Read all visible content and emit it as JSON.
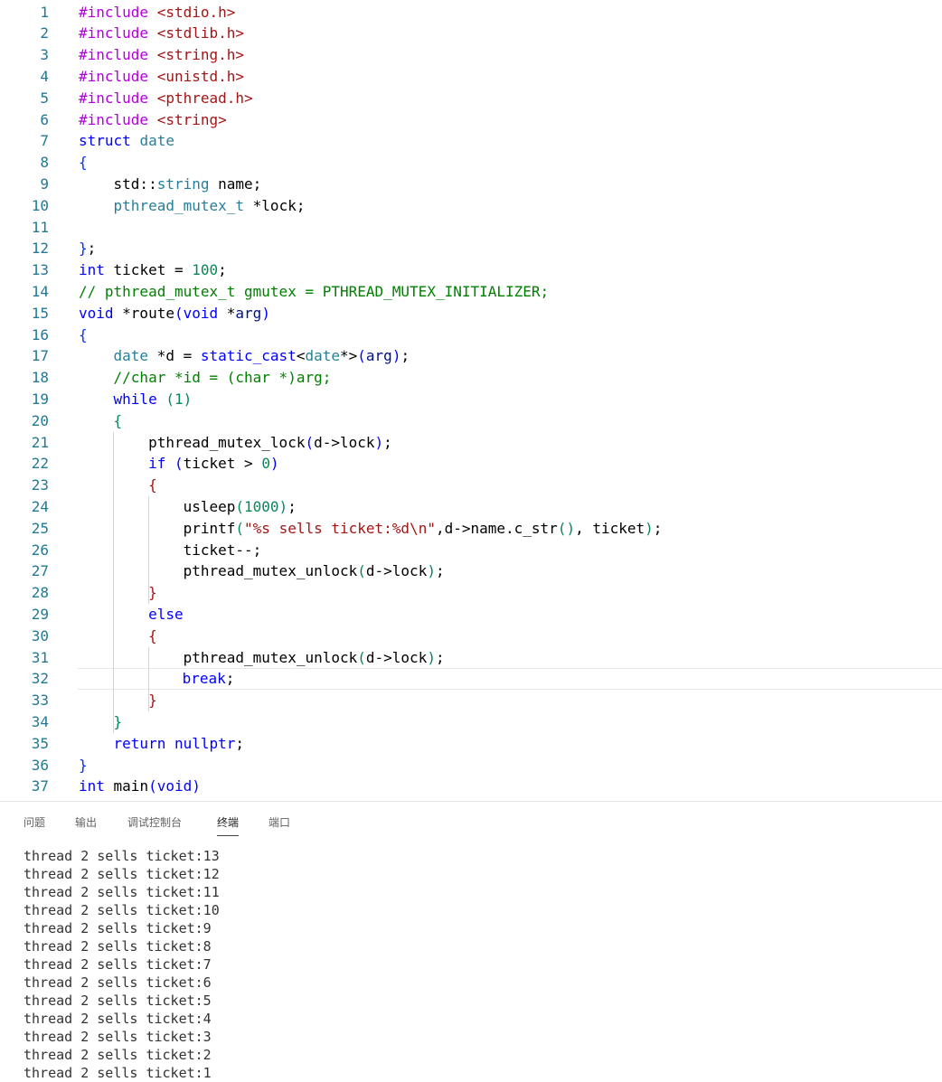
{
  "editor": {
    "lines": [
      {
        "n": "1",
        "segs": [
          [
            "pp",
            "#include "
          ],
          [
            "s",
            "<stdio.h>"
          ]
        ]
      },
      {
        "n": "2",
        "segs": [
          [
            "pp",
            "#include "
          ],
          [
            "s",
            "<stdlib.h>"
          ]
        ]
      },
      {
        "n": "3",
        "segs": [
          [
            "pp",
            "#include "
          ],
          [
            "s",
            "<string.h>"
          ]
        ]
      },
      {
        "n": "4",
        "segs": [
          [
            "pp",
            "#include "
          ],
          [
            "s",
            "<unistd.h>"
          ]
        ]
      },
      {
        "n": "5",
        "segs": [
          [
            "pp",
            "#include "
          ],
          [
            "s",
            "<pthread.h>"
          ]
        ]
      },
      {
        "n": "6",
        "segs": [
          [
            "pp",
            "#include "
          ],
          [
            "s",
            "<string>"
          ]
        ]
      },
      {
        "n": "7",
        "segs": [
          [
            "k",
            "struct "
          ],
          [
            "t",
            "date"
          ]
        ]
      },
      {
        "n": "8",
        "segs": [
          [
            "b",
            "{"
          ]
        ]
      },
      {
        "n": "9",
        "segs": [
          [
            "p",
            "    std::"
          ],
          [
            "t",
            "string"
          ],
          [
            "p",
            " name;"
          ]
        ]
      },
      {
        "n": "10",
        "segs": [
          [
            "p",
            "    "
          ],
          [
            "t",
            "pthread_mutex_t"
          ],
          [
            "p",
            " *lock;"
          ]
        ]
      },
      {
        "n": "11",
        "segs": [
          [
            "p",
            ""
          ]
        ]
      },
      {
        "n": "12",
        "segs": [
          [
            "b",
            "}"
          ],
          [
            "p",
            ";"
          ]
        ]
      },
      {
        "n": "13",
        "segs": [
          [
            "k",
            "int"
          ],
          [
            "p",
            " ticket = "
          ],
          [
            "n",
            "100"
          ],
          [
            "p",
            ";"
          ]
        ]
      },
      {
        "n": "14",
        "segs": [
          [
            "c",
            "// pthread_mutex_t gmutex = PTHREAD_MUTEX_INITIALIZER;"
          ]
        ]
      },
      {
        "n": "15",
        "segs": [
          [
            "k",
            "void"
          ],
          [
            "p",
            " *route"
          ],
          [
            "k",
            "("
          ],
          [
            "k",
            "void"
          ],
          [
            "p",
            " *"
          ],
          [
            "v",
            "arg"
          ],
          [
            "k",
            ")"
          ]
        ]
      },
      {
        "n": "16",
        "segs": [
          [
            "b",
            "{"
          ]
        ]
      },
      {
        "n": "17",
        "segs": [
          [
            "p",
            "    "
          ],
          [
            "t",
            "date"
          ],
          [
            "p",
            " *d = "
          ],
          [
            "k",
            "static_cast"
          ],
          [
            "p",
            "<"
          ],
          [
            "t",
            "date"
          ],
          [
            "p",
            "*>"
          ],
          [
            "k",
            "("
          ],
          [
            "v",
            "arg"
          ],
          [
            "k",
            ")"
          ],
          [
            "p",
            ";"
          ]
        ]
      },
      {
        "n": "18",
        "segs": [
          [
            "p",
            "    "
          ],
          [
            "c",
            "//char *id = (char *)arg;"
          ]
        ]
      },
      {
        "n": "19",
        "segs": [
          [
            "p",
            "    "
          ],
          [
            "k",
            "while"
          ],
          [
            "p",
            " "
          ],
          [
            "n",
            "(1)"
          ]
        ]
      },
      {
        "n": "20",
        "segs": [
          [
            "p",
            "    "
          ],
          [
            "n",
            "{"
          ]
        ]
      },
      {
        "n": "21",
        "segs": [
          [
            "p",
            "        pthread_mutex_lock"
          ],
          [
            "k",
            "("
          ],
          [
            "p",
            "d->lock"
          ],
          [
            "k",
            ")"
          ],
          [
            "p",
            ";"
          ]
        ]
      },
      {
        "n": "22",
        "segs": [
          [
            "p",
            "        "
          ],
          [
            "k",
            "if"
          ],
          [
            "p",
            " "
          ],
          [
            "k",
            "("
          ],
          [
            "p",
            "ticket > "
          ],
          [
            "n",
            "0"
          ],
          [
            "k",
            ")"
          ]
        ]
      },
      {
        "n": "23",
        "segs": [
          [
            "p",
            "        "
          ],
          [
            "s",
            "{"
          ]
        ]
      },
      {
        "n": "24",
        "segs": [
          [
            "p",
            "            usleep"
          ],
          [
            "n",
            "(1000)"
          ],
          [
            "p",
            ";"
          ]
        ]
      },
      {
        "n": "25",
        "segs": [
          [
            "p",
            "            printf"
          ],
          [
            "n",
            "("
          ],
          [
            "s",
            "\"%s sells ticket:%d\\n\""
          ],
          [
            "p",
            ",d->name.c_str"
          ],
          [
            "n",
            "()"
          ],
          [
            "p",
            ", ticket"
          ],
          [
            "n",
            ")"
          ],
          [
            "p",
            ";"
          ]
        ]
      },
      {
        "n": "26",
        "segs": [
          [
            "p",
            "            ticket--;"
          ]
        ]
      },
      {
        "n": "27",
        "segs": [
          [
            "p",
            "            pthread_mutex_unlock"
          ],
          [
            "n",
            "("
          ],
          [
            "p",
            "d->lock"
          ],
          [
            "n",
            ")"
          ],
          [
            "p",
            ";"
          ]
        ]
      },
      {
        "n": "28",
        "segs": [
          [
            "p",
            "        "
          ],
          [
            "s",
            "}"
          ]
        ]
      },
      {
        "n": "29",
        "segs": [
          [
            "p",
            "        "
          ],
          [
            "k",
            "else"
          ]
        ]
      },
      {
        "n": "30",
        "segs": [
          [
            "p",
            "        "
          ],
          [
            "s",
            "{"
          ]
        ]
      },
      {
        "n": "31",
        "segs": [
          [
            "p",
            "            pthread_mutex_unlock"
          ],
          [
            "n",
            "("
          ],
          [
            "p",
            "d->lock"
          ],
          [
            "n",
            ")"
          ],
          [
            "p",
            ";"
          ]
        ]
      },
      {
        "n": "32",
        "segs": [
          [
            "p",
            "            "
          ],
          [
            "k",
            "break"
          ],
          [
            "p",
            ";"
          ]
        ]
      },
      {
        "n": "33",
        "segs": [
          [
            "p",
            "        "
          ],
          [
            "s",
            "}"
          ]
        ]
      },
      {
        "n": "34",
        "segs": [
          [
            "p",
            "    "
          ],
          [
            "n",
            "}"
          ]
        ]
      },
      {
        "n": "35",
        "segs": [
          [
            "p",
            "    "
          ],
          [
            "k",
            "return"
          ],
          [
            "p",
            " "
          ],
          [
            "k",
            "nullptr"
          ],
          [
            "p",
            ";"
          ]
        ]
      },
      {
        "n": "36",
        "segs": [
          [
            "b",
            "}"
          ]
        ]
      },
      {
        "n": "37",
        "segs": [
          [
            "k",
            "int"
          ],
          [
            "p",
            " main"
          ],
          [
            "k",
            "("
          ],
          [
            "k",
            "void"
          ],
          [
            "k",
            ")"
          ]
        ]
      }
    ]
  },
  "panel": {
    "tabs": [
      "问题",
      "输出",
      "调试控制台",
      "终端",
      "端口"
    ],
    "active_tab": "终端",
    "terminal_lines": [
      "thread 2 sells ticket:13",
      "thread 2 sells ticket:12",
      "thread 2 sells ticket:11",
      "thread 2 sells ticket:10",
      "thread 2 sells ticket:9",
      "thread 2 sells ticket:8",
      "thread 2 sells ticket:7",
      "thread 2 sells ticket:6",
      "thread 2 sells ticket:5",
      "thread 2 sells ticket:4",
      "thread 2 sells ticket:3",
      "thread 2 sells ticket:2",
      "thread 2 sells ticket:1"
    ]
  }
}
